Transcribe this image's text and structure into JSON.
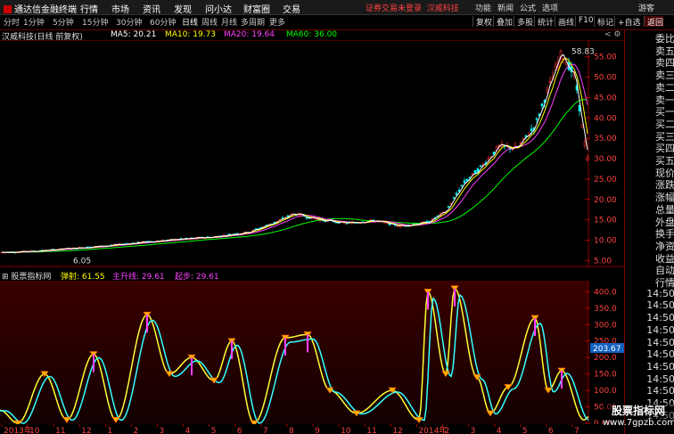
{
  "app": {
    "title": "通达信金融终端"
  },
  "menu": [
    "行情",
    "市场",
    "资讯",
    "发现",
    "问小达",
    "财富圈",
    "交易"
  ],
  "login_notice": "证券交易未登录",
  "stock_name_top": "汉威科技",
  "right_menu": [
    "功能",
    "新闻",
    "公式",
    "选项",
    "游客"
  ],
  "periods": [
    "分时",
    "1分钟",
    "5分钟",
    "15分钟",
    "30分钟",
    "60分钟",
    "日线",
    "周线",
    "月线",
    "多周期",
    "更多"
  ],
  "active_period": "日线",
  "tool_buttons": [
    "复权",
    "叠加",
    "多股",
    "统计",
    "画线",
    "F10",
    "标记",
    "+自选",
    "返回"
  ],
  "chart_info": {
    "name": "汉威科技(日线 前复权)",
    "ma5": "MA5: 20.21",
    "ma10": "MA10: 19.73",
    "ma20": "MA20: 19.64",
    "ma60": "MA60: 36.00"
  },
  "colors": {
    "ma5": "#ffffff",
    "ma10": "#ffff00",
    "ma20": "#ff40ff",
    "ma60": "#00ff00",
    "up": "#ff3030",
    "down": "#00ffff"
  },
  "main_axis_labels": [
    "55.00",
    "50.00",
    "45.00",
    "40.00",
    "35.00",
    "30.00",
    "25.00",
    "20.00",
    "15.00",
    "10.00",
    "5.00"
  ],
  "main_axis_values": [
    55,
    50,
    45,
    40,
    35,
    30,
    25,
    20,
    15,
    10,
    5
  ],
  "high_label": "58.83",
  "low_label": "6.05",
  "sub_info": {
    "name": "股票指标网",
    "tan": "弹射: 61.55",
    "zsx": "主升线: 29.61",
    "qb": "起步: 29.61"
  },
  "sub_axis_labels": [
    "400.0",
    "350.0",
    "300.0",
    "250.0",
    "200.0",
    "150.0",
    "100.0",
    "50.00",
    "0.00"
  ],
  "sub_axis_values": [
    400,
    350,
    300,
    250,
    200,
    150,
    100,
    50,
    0
  ],
  "sub_current": "203.67",
  "x_labels": [
    "2013年",
    "10",
    "11",
    "12",
    "1",
    "2",
    "3",
    "4",
    "5",
    "6",
    "7",
    "8",
    "9",
    "10",
    "11",
    "12",
    "2014年",
    "2",
    "3",
    "4",
    "5",
    "6",
    "7"
  ],
  "right_panel": [
    "委比",
    "卖五",
    "卖四",
    "卖三",
    "卖二",
    "卖一",
    "买一",
    "买二",
    "买三",
    "买四",
    "买五",
    "现价",
    "涨跌",
    "涨幅",
    "总量",
    "外盘",
    "换手",
    "净资",
    "收益",
    "自动",
    "行情",
    "14:50",
    "14:50",
    "14:50",
    "14:50",
    "14:50",
    "14:50",
    "14:50",
    "14:50",
    "14:50",
    "14:50",
    "14:50"
  ],
  "watermark": {
    "title": "股票指标网",
    "url": "www.7gpzb.com"
  }
}
